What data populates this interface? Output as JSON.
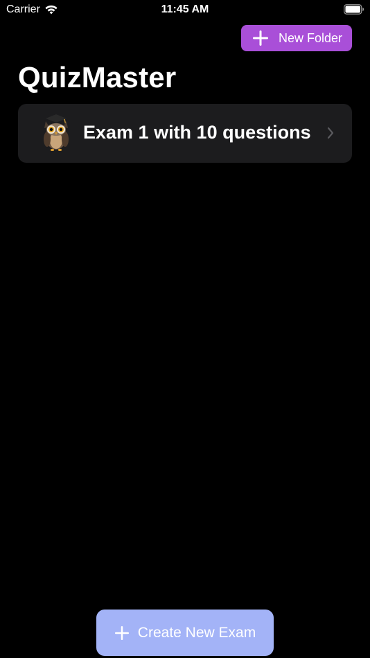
{
  "status_bar": {
    "carrier": "Carrier",
    "time": "11:45 AM",
    "wifi_icon": "wifi-icon",
    "battery_icon": "battery-icon"
  },
  "header": {
    "new_folder_label": "New Folder",
    "new_folder_icon": "plus-icon",
    "title": "QuizMaster"
  },
  "exams": [
    {
      "title": "Exam 1 with 10 questions",
      "avatar_icon": "owl-icon",
      "chevron_icon": "chevron-right-icon"
    }
  ],
  "footer": {
    "create_exam_label": "Create New Exam",
    "create_exam_icon": "plus-icon"
  },
  "colors": {
    "background": "#000000",
    "row_background": "#1c1c1e",
    "new_folder_button": "#a94fd8",
    "create_exam_button": "#a3b3f7",
    "chevron": "#5a5a5e"
  }
}
